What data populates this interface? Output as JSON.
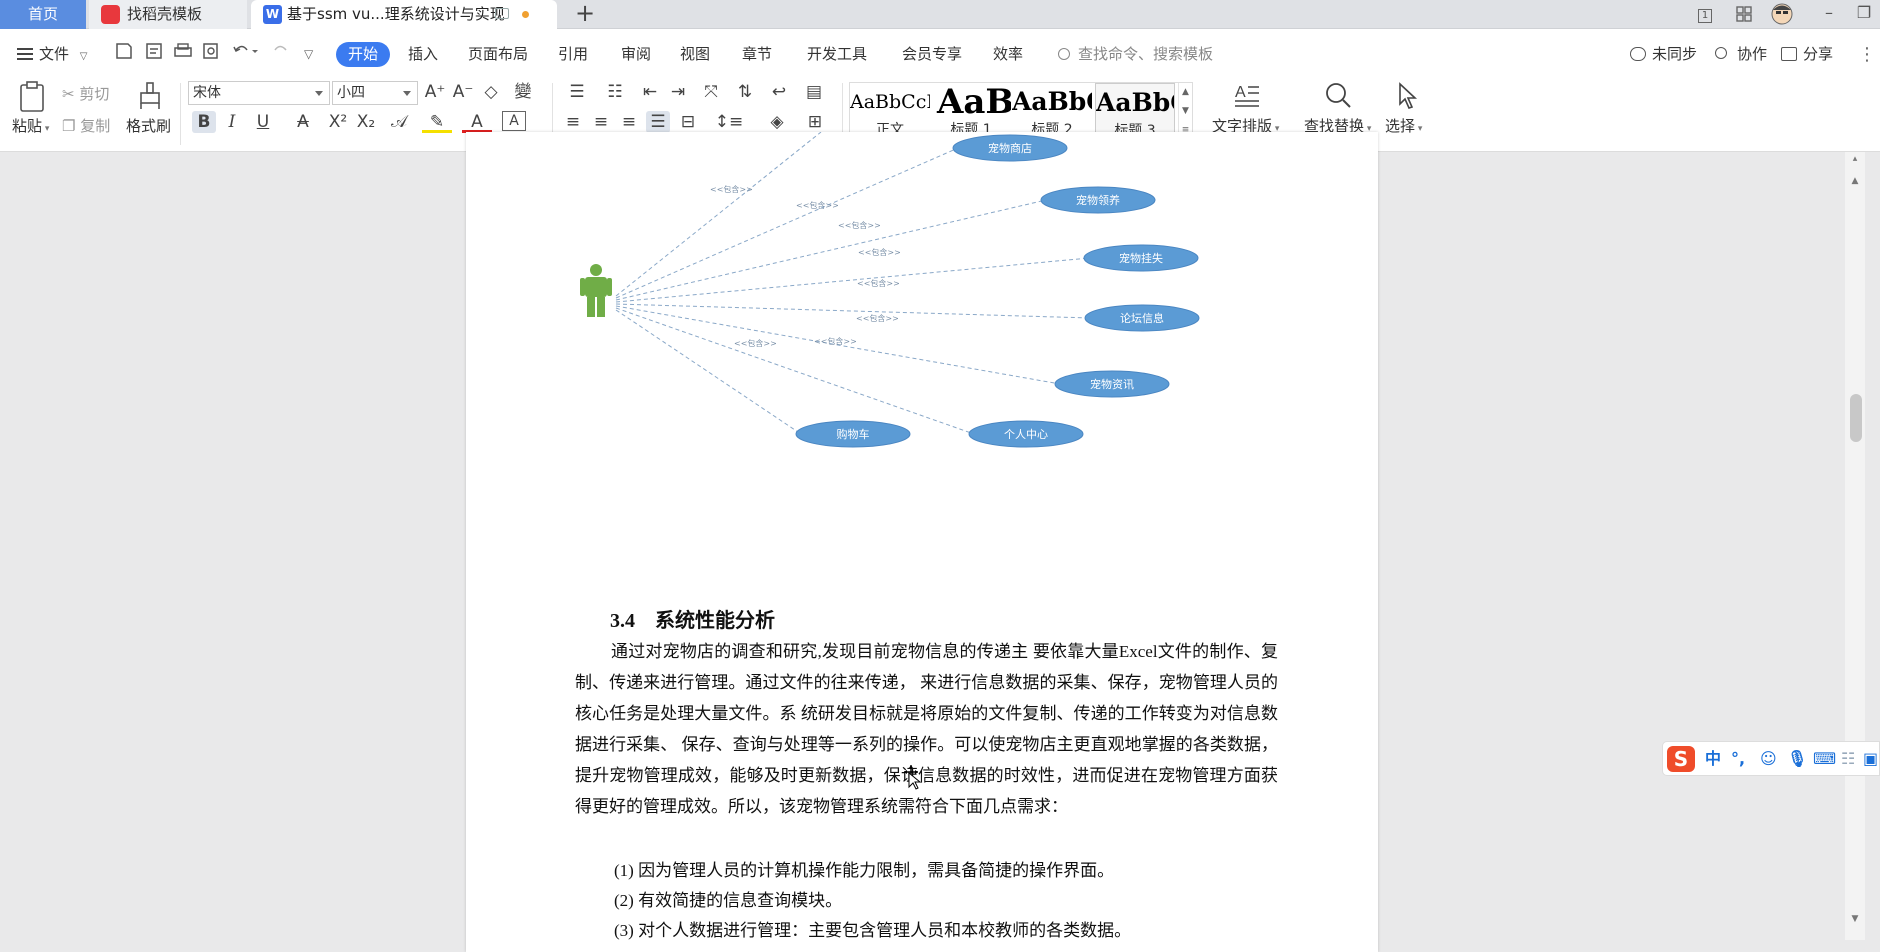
{
  "tabs": {
    "home": "首页",
    "template": "找稻壳模板",
    "document": "基于ssm vu...理系统设计与实现",
    "add": "+"
  },
  "window": {
    "page_badge": "1",
    "min": "–",
    "restore": "❐"
  },
  "menu": {
    "file": "文件",
    "items": [
      "开始",
      "插入",
      "页面布局",
      "引用",
      "审阅",
      "视图",
      "章节",
      "开发工具",
      "会员专享",
      "效率"
    ],
    "search_placeholder": "查找命令、搜索模板",
    "sync": "未同步",
    "collab": "协作",
    "share": "分享"
  },
  "ribbon": {
    "paste": "粘贴",
    "cut": "剪切",
    "copy": "复制",
    "format_painter": "格式刷",
    "font_name": "宋体",
    "font_size": "小四",
    "styles": [
      {
        "preview": "AaBbCcI",
        "name": "正文"
      },
      {
        "preview": "AaBl",
        "name": "标题 1"
      },
      {
        "preview": "AaBbC",
        "name": "标题 2"
      },
      {
        "preview": "AaBbC",
        "name": "标题 3"
      }
    ],
    "text_layout": "文字排版",
    "find_replace": "查找替换",
    "select": "选择"
  },
  "diagram": {
    "edge_label": "<<包含>>",
    "use_cases": [
      "宠物商店",
      "宠物领养",
      "宠物挂失",
      "论坛信息",
      "宠物资讯",
      "个人中心",
      "购物车"
    ]
  },
  "document": {
    "section_heading": "3.4    系统性能分析",
    "paragraph": "通过对宠物店的调查和研究,发现目前宠物信息的传递主  要依靠大量Excel文件的制作、复制、传递来进行管理。通过文件的往来传递，  来进行信息数据的采集、保存，宠物管理人员的核心任务是处理大量文件。系  统研发目标就是将原始的文件复制、传递的工作转变为对信息数据进行采集、  保存、查询与处理等一系列的操作。可以使宠物店主更直观地掌握的各类数据，提升宠物管理成效，能够及时更新数据，保证信息数据的时效性，进而促进在宠物管理方面获得更好的管理成效。所以，该宠物管理系统需符合下面几点需求：",
    "list": [
      "(1)  因为管理人员的计算机操作能力限制，需具备简捷的操作界面。",
      "(2)  有效简捷的信息查询模块。",
      "(3)  对个人数据进行管理：主要包含管理人员和本校教师的各类数据。"
    ]
  },
  "ime": {
    "lang": "中",
    "punct": "°,"
  },
  "colors": {
    "accent": "#3b7bf0",
    "use_case_fill": "#5b9bd5",
    "actor": "#70ad47"
  }
}
